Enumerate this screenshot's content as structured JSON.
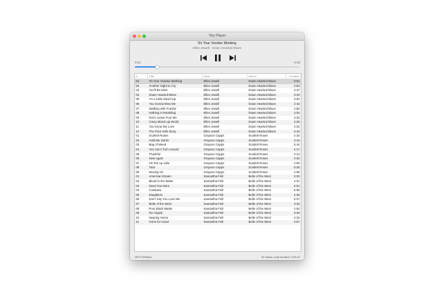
{
  "window": {
    "title": "Tiny Player"
  },
  "now_playing": {
    "title": "It's Your Voodoo Working",
    "subtitle": "Ellen Jewell - Down Hearted Blues",
    "elapsed": "0:24",
    "remaining": "-2:38",
    "progress": 0.138
  },
  "table": {
    "columns": [
      "#",
      "Title",
      "Artist",
      "Album",
      "Duration"
    ],
    "rows": [
      {
        "num": "01",
        "title": "It's Your Voodoo Working",
        "artist": "Ellen Jewell",
        "album": "Down Hearted Blues",
        "duration": "3:01"
      },
      {
        "num": "02",
        "title": "Another Night to Cry",
        "artist": "Ellen Jewell",
        "album": "Down Hearted Blues",
        "duration": "2:53"
      },
      {
        "num": "03",
        "title": "You'll Be Mine",
        "artist": "Ellen Jewell",
        "album": "Down Hearted Blues",
        "duration": "2:37"
      },
      {
        "num": "04",
        "title": "Down Hearted Blues",
        "artist": "Ellen Jewell",
        "album": "Down Hearted Blues",
        "duration": "3:40"
      },
      {
        "num": "05",
        "title": "I'm a Little Mixed Up",
        "artist": "Ellen Jewell",
        "album": "Down Hearted Blues",
        "duration": "3:02"
      },
      {
        "num": "06",
        "title": "You Gonna Miss Me",
        "artist": "Ellen Jewell",
        "album": "Down Hearted Blues",
        "duration": "2:43"
      },
      {
        "num": "07",
        "title": "Walking with Frankie",
        "artist": "Ellen Jewell",
        "album": "Down Hearted Blues",
        "duration": "2:50"
      },
      {
        "num": "08",
        "title": "Nothing in Rambling",
        "artist": "Ellen Jewell",
        "album": "Down Hearted Blues",
        "duration": "3:04"
      },
      {
        "num": "09",
        "title": "Don't Leave Poor Me",
        "artist": "Ellen Jewell",
        "album": "Down Hearted Blues",
        "duration": "2:34"
      },
      {
        "num": "10",
        "title": "Crazy Mixed Up World",
        "artist": "Ellen Jewell",
        "album": "Down Hearted Blues",
        "duration": "2:28"
      },
      {
        "num": "11",
        "title": "You Know My Love",
        "artist": "Ellen Jewell",
        "album": "Down Hearted Blues",
        "duration": "4:24"
      },
      {
        "num": "12",
        "title": "The Poor Girls Story",
        "artist": "Ellen Jewell",
        "album": "Down Hearted Blues",
        "duration": "3:42"
      },
      {
        "num": "01",
        "title": "Scarlett Roses",
        "artist": "Grayson Capps",
        "album": "Scarlett Roses",
        "duration": "4:33"
      },
      {
        "num": "02",
        "title": "Hold Me Darlin'",
        "artist": "Grayson Capps",
        "album": "Scarlett Roses",
        "duration": "3:15"
      },
      {
        "num": "03",
        "title": "Bag of Weed",
        "artist": "Grayson Capps",
        "album": "Scarlett Roses",
        "duration": "5:44"
      },
      {
        "num": "04",
        "title": "You Can't Turn Around",
        "artist": "Grayson Capps",
        "album": "Scarlett Roses",
        "duration": "4:17"
      },
      {
        "num": "05",
        "title": "Thankful",
        "artist": "Grayson Capps",
        "album": "Scarlett Roses",
        "duration": "3:13"
      },
      {
        "num": "06",
        "title": "New Again",
        "artist": "Grayson Capps",
        "album": "Scarlett Roses",
        "duration": "4:34"
      },
      {
        "num": "07",
        "title": "Hit 'Em up Julie",
        "artist": "Grayson Capps",
        "album": "Scarlett Roses",
        "duration": "2:50"
      },
      {
        "num": "08",
        "title": "Taos",
        "artist": "Grayson Capps",
        "album": "Scarlett Roses",
        "duration": "8:28"
      },
      {
        "num": "09",
        "title": "Moving On",
        "artist": "Grayson Capps",
        "album": "Scarlett Roses",
        "duration": "4:08"
      },
      {
        "num": "01",
        "title": "American Dream",
        "artist": "Samantha Fish",
        "album": "Belle of the West",
        "duration": "3:20"
      },
      {
        "num": "02",
        "title": "Blood in the Water",
        "artist": "Samantha Fish",
        "album": "Belle of the West",
        "duration": "4:01"
      },
      {
        "num": "03",
        "title": "Need You More",
        "artist": "Samantha Fish",
        "album": "Belle of the West",
        "duration": "4:01"
      },
      {
        "num": "04",
        "title": "Cowtown",
        "artist": "Samantha Fish",
        "album": "Belle of the West",
        "duration": "5:08"
      },
      {
        "num": "05",
        "title": "Daughters",
        "artist": "Samantha Fish",
        "album": "Belle of the West",
        "duration": "4:36"
      },
      {
        "num": "06",
        "title": "Don't Say You Love Me",
        "artist": "Samantha Fish",
        "album": "Belle of the West",
        "duration": "5:27"
      },
      {
        "num": "07",
        "title": "Belle of the West",
        "artist": "Samantha Fish",
        "album": "Belle of the West",
        "duration": "3:33"
      },
      {
        "num": "08",
        "title": "Poor Black Mattie",
        "artist": "Samantha Fish",
        "album": "Belle of the West",
        "duration": "4:54"
      },
      {
        "num": "09",
        "title": "No Angels",
        "artist": "Samantha Fish",
        "album": "Belle of the West",
        "duration": "3:30"
      },
      {
        "num": "10",
        "title": "Nearing Home",
        "artist": "Samantha Fish",
        "album": "Belle of the West",
        "duration": "4:15"
      },
      {
        "num": "11",
        "title": "Gone for Good",
        "artist": "Samantha Fish",
        "album": "Belle of the West",
        "duration": "3:57"
      }
    ]
  },
  "status": {
    "format": "MP3 320kbps",
    "summary": "32 tracks, total duration 2:05:42"
  },
  "colors": {
    "accent": "#3d8ef0",
    "close": "#fc605c",
    "minimize": "#fdbc40",
    "maximize": "#34c84a"
  },
  "icons": [
    "close-icon",
    "minimize-icon",
    "maximize-icon",
    "previous-track-icon",
    "pause-icon",
    "next-track-icon"
  ]
}
